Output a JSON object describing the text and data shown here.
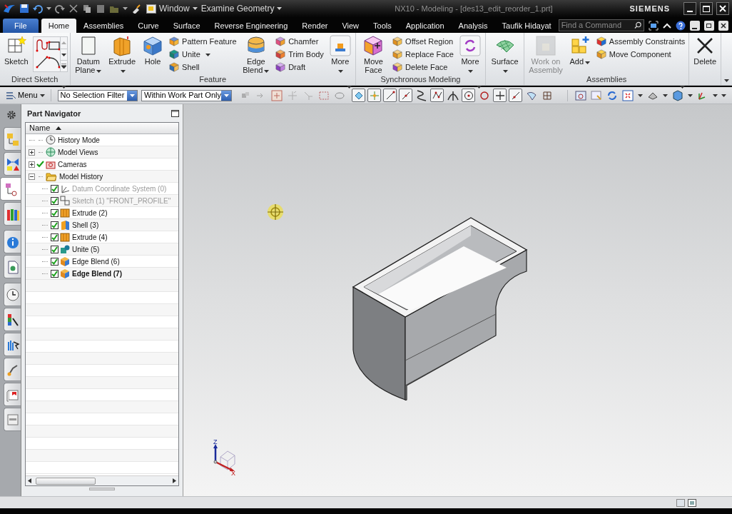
{
  "title_bar": {
    "window_menu": "Window",
    "command_finder": "Examine Geometry",
    "title": "NX10 - Modeling - [des13_edit_reorder_1.prt]",
    "brand": "SIEMENS"
  },
  "tabs": [
    {
      "label": "File",
      "kind": "file",
      "selected": false
    },
    {
      "label": "Home",
      "kind": "tab",
      "selected": true
    },
    {
      "label": "Assemblies",
      "kind": "tab",
      "selected": false
    },
    {
      "label": "Curve",
      "kind": "tab",
      "selected": false
    },
    {
      "label": "Surface",
      "kind": "tab",
      "selected": false
    },
    {
      "label": "Reverse Engineering",
      "kind": "tab",
      "selected": false
    },
    {
      "label": "Render",
      "kind": "tab",
      "selected": false
    },
    {
      "label": "View",
      "kind": "tab",
      "selected": false
    },
    {
      "label": "Tools",
      "kind": "tab",
      "selected": false
    },
    {
      "label": "Application",
      "kind": "tab",
      "selected": false
    },
    {
      "label": "Analysis",
      "kind": "tab",
      "selected": false
    }
  ],
  "user": "Taufik Hidayat",
  "search": {
    "placeholder": "Find a Command"
  },
  "ribbon": {
    "groups": [
      {
        "label": "Direct Sketch",
        "items": [
          {
            "kind": "large",
            "label": "Sketch",
            "menu": false,
            "disabled": false
          },
          {
            "kind": "gallery"
          }
        ]
      },
      {
        "label": "Feature",
        "items": [
          {
            "kind": "large",
            "label": "Datum Plane",
            "menu": true,
            "disabled": false
          },
          {
            "kind": "large",
            "label": "Extrude",
            "menu": true,
            "disabled": false
          },
          {
            "kind": "large",
            "label": "Hole",
            "menu": false,
            "disabled": false
          },
          {
            "kind": "column",
            "entries": [
              {
                "label": "Pattern Feature",
                "menu": false
              },
              {
                "label": "Unite",
                "menu": true
              },
              {
                "label": "Shell",
                "menu": false
              }
            ]
          },
          {
            "kind": "large",
            "label": "Edge Blend",
            "menu": true,
            "disabled": false
          },
          {
            "kind": "column",
            "entries": [
              {
                "label": "Chamfer",
                "menu": false
              },
              {
                "label": "Trim Body",
                "menu": false
              },
              {
                "label": "Draft",
                "menu": false
              }
            ]
          },
          {
            "kind": "large",
            "label": "More",
            "menu": true,
            "disabled": false
          }
        ]
      },
      {
        "label": "Synchronous Modeling",
        "items": [
          {
            "kind": "large",
            "label": "Move Face",
            "menu": false,
            "disabled": false
          },
          {
            "kind": "column",
            "entries": [
              {
                "label": "Offset Region",
                "menu": false
              },
              {
                "label": "Replace Face",
                "menu": false
              },
              {
                "label": "Delete Face",
                "menu": false
              }
            ]
          },
          {
            "kind": "large",
            "label": "More",
            "menu": true,
            "disabled": false
          }
        ]
      },
      {
        "items": [
          {
            "kind": "large",
            "label": "Surface",
            "menu": true,
            "disabled": false
          }
        ]
      },
      {
        "label": "Assemblies",
        "items": [
          {
            "kind": "large",
            "label": "Work on Assembly",
            "menu": false,
            "disabled": true
          },
          {
            "kind": "large",
            "label": "Add",
            "menu": true,
            "disabled": false
          },
          {
            "kind": "column",
            "entries": [
              {
                "label": "Assembly Constraints",
                "menu": false
              },
              {
                "label": "Move Component",
                "menu": false
              }
            ]
          }
        ]
      },
      {
        "items": [
          {
            "kind": "large",
            "label": "Delete",
            "menu": false,
            "disabled": false
          }
        ]
      }
    ]
  },
  "toolbar": {
    "menu": "Menu",
    "filters": [
      {
        "value": "No Selection Filter"
      },
      {
        "value": "Within Work Part Only"
      }
    ],
    "snaps": [
      {
        "on": true
      },
      {
        "on": true
      },
      {
        "on": true
      },
      {
        "on": true
      },
      {
        "on": false
      },
      {
        "on": true
      },
      {
        "on": false
      },
      {
        "on": true
      },
      {
        "on": false
      },
      {
        "on": true
      },
      {
        "on": true
      },
      {
        "on": false
      },
      {
        "on": false
      }
    ]
  },
  "resource_bar": [
    {
      "selected": false
    },
    {
      "selected": false
    },
    {
      "selected": true
    },
    {
      "selected": false
    },
    {
      "selected": false
    },
    {
      "selected": false
    },
    {
      "selected": false
    },
    {
      "selected": false
    },
    {
      "selected": false
    },
    {
      "selected": false
    },
    {
      "selected": false
    },
    {
      "selected": false
    }
  ],
  "part_navigator": {
    "title": "Part Navigator",
    "column": "Name",
    "tree": [
      {
        "label": "History Mode",
        "checked": false
      },
      {
        "label": "Model Views",
        "checked": false,
        "expanded": false
      },
      {
        "label": "Cameras",
        "checked": true,
        "expanded": false
      },
      {
        "label": "Model History",
        "checked": false,
        "expanded": true,
        "children": [
          {
            "label": "Datum Coordinate System (0)",
            "checked": true,
            "dimmed": true,
            "current": false
          },
          {
            "label": "Sketch (1) \"FRONT_PROFILE\"",
            "checked": true,
            "dimmed": true,
            "current": false
          },
          {
            "label": "Extrude (2)",
            "checked": true,
            "dimmed": false,
            "current": false
          },
          {
            "label": "Shell (3)",
            "checked": true,
            "dimmed": false,
            "current": false
          },
          {
            "label": "Extrude (4)",
            "checked": true,
            "dimmed": false,
            "current": false
          },
          {
            "label": "Unite (5)",
            "checked": true,
            "dimmed": false,
            "current": false
          },
          {
            "label": "Edge Blend (6)",
            "checked": true,
            "dimmed": false,
            "current": false
          },
          {
            "label": "Edge Blend (7)",
            "checked": true,
            "dimmed": false,
            "current": true
          }
        ]
      }
    ]
  },
  "viewport": {
    "triad": {
      "z": "Z",
      "x": "X"
    }
  }
}
